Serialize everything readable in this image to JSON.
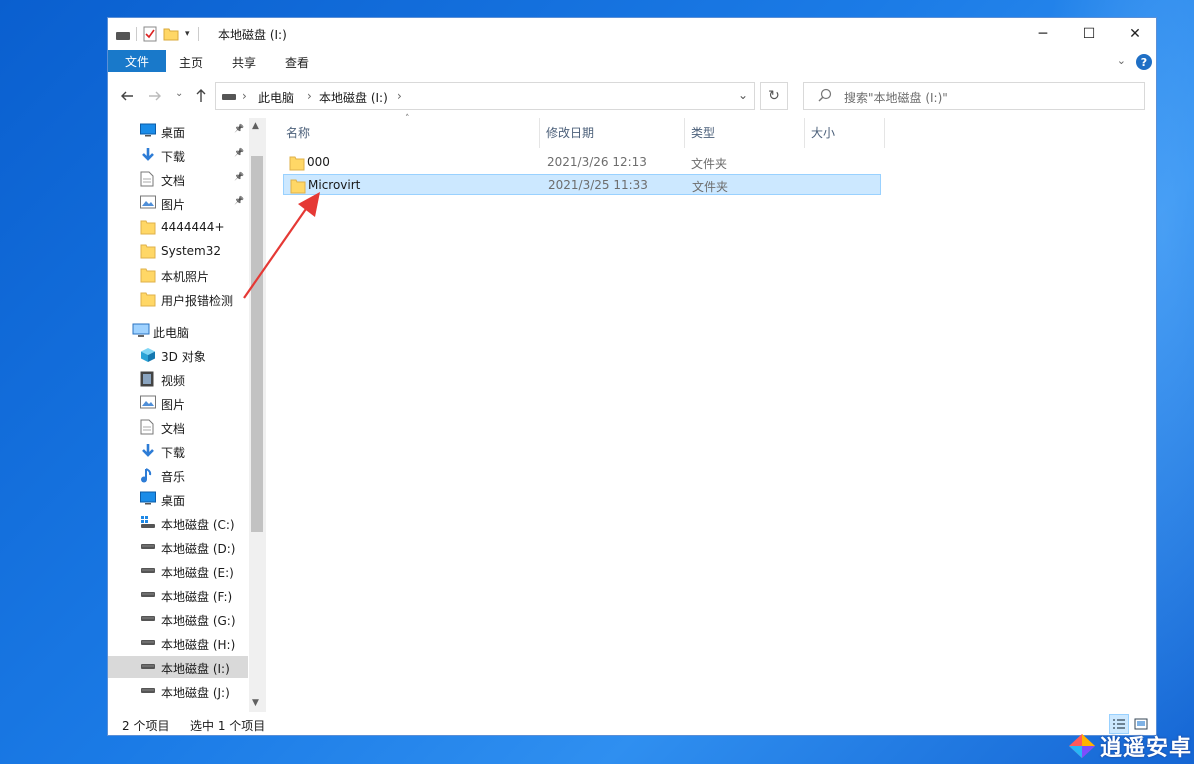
{
  "window": {
    "title": "本地磁盘 (I:)",
    "controls": {
      "minimize": "─",
      "maximize": "☐",
      "close": "✕"
    }
  },
  "ribbon": {
    "tabs": [
      "文件",
      "主页",
      "共享",
      "查看"
    ],
    "help": "?"
  },
  "address": {
    "segments": [
      "此电脑",
      "本地磁盘 (I:)"
    ],
    "search_placeholder": "搜索\"本地磁盘 (I:)\""
  },
  "sidebar": {
    "quick_access": [
      {
        "label": "桌面",
        "icon": "desktop-icon",
        "pinned": true
      },
      {
        "label": "下载",
        "icon": "download-icon",
        "pinned": true
      },
      {
        "label": "文档",
        "icon": "document-icon",
        "pinned": true
      },
      {
        "label": "图片",
        "icon": "picture-icon",
        "pinned": true
      },
      {
        "label": "4444444+",
        "icon": "folder-icon",
        "pinned": false
      },
      {
        "label": "System32",
        "icon": "folder-icon",
        "pinned": false
      },
      {
        "label": "本机照片",
        "icon": "folder-icon",
        "pinned": false
      },
      {
        "label": "用户报错检测",
        "icon": "folder-icon",
        "pinned": false
      }
    ],
    "this_pc": {
      "label": "此电脑",
      "icon": "computer-icon"
    },
    "this_pc_items": [
      {
        "label": "3D 对象",
        "icon": "cube-3d-icon"
      },
      {
        "label": "视频",
        "icon": "video-icon"
      },
      {
        "label": "图片",
        "icon": "picture-icon"
      },
      {
        "label": "文档",
        "icon": "document-icon"
      },
      {
        "label": "下载",
        "icon": "download-icon"
      },
      {
        "label": "音乐",
        "icon": "music-icon"
      },
      {
        "label": "桌面",
        "icon": "desktop-icon"
      },
      {
        "label": "本地磁盘 (C:)",
        "icon": "windows-drive-icon"
      },
      {
        "label": "本地磁盘 (D:)",
        "icon": "drive-icon"
      },
      {
        "label": "本地磁盘 (E:)",
        "icon": "drive-icon"
      },
      {
        "label": "本地磁盘 (F:)",
        "icon": "drive-icon"
      },
      {
        "label": "本地磁盘 (G:)",
        "icon": "drive-icon"
      },
      {
        "label": "本地磁盘 (H:)",
        "icon": "drive-icon"
      },
      {
        "label": "本地磁盘 (I:)",
        "icon": "drive-icon",
        "selected": true
      },
      {
        "label": "本地磁盘 (J:)",
        "icon": "drive-icon"
      }
    ]
  },
  "columns": [
    "名称",
    "修改日期",
    "类型",
    "大小"
  ],
  "files": [
    {
      "name": "000",
      "modified": "2021/3/26 12:13",
      "type": "文件夹",
      "size": ""
    },
    {
      "name": "Microvirt",
      "modified": "2021/3/25 11:33",
      "type": "文件夹",
      "size": "",
      "selected": true
    }
  ],
  "status": {
    "count": "2 个项目",
    "selection": "选中 1 个项目"
  },
  "watermark": "逍遥安卓",
  "colors": {
    "accent": "#1979ca",
    "selection": "#cce8ff",
    "arrow": "#e53935"
  }
}
